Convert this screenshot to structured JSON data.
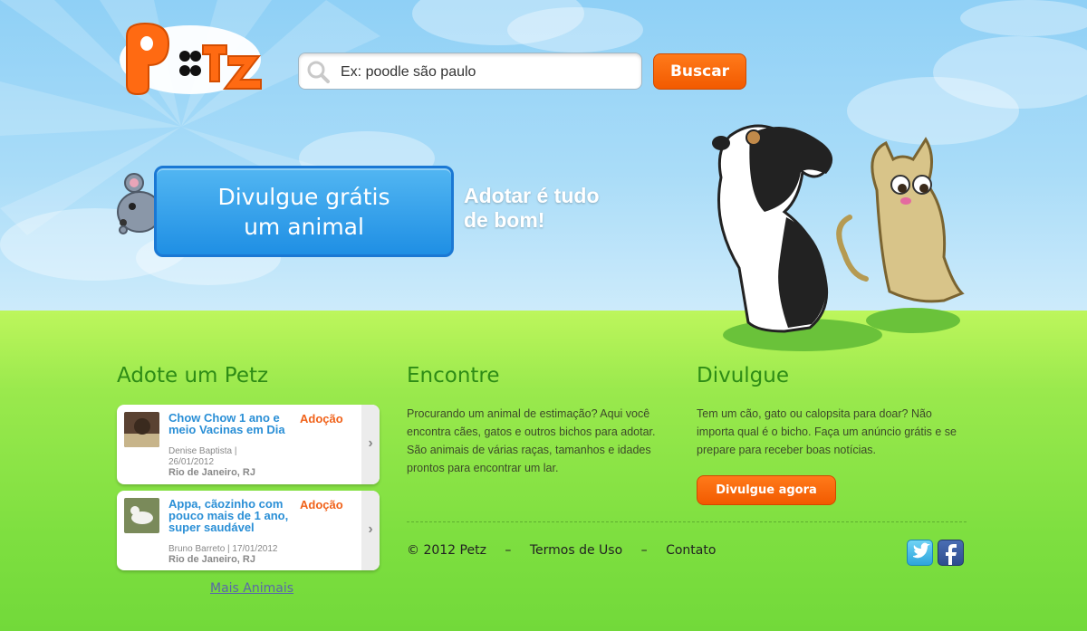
{
  "brand": {
    "logo_text": "PETZ"
  },
  "search": {
    "placeholder": "Ex: poodle são paulo",
    "button_label": "Buscar"
  },
  "hero": {
    "promo_line1": "Divulgue grátis",
    "promo_line2": "um animal",
    "tagline_line1": "Adotar é tudo",
    "tagline_line2": "de bom!"
  },
  "adote": {
    "title": "Adote um Petz",
    "cards": [
      {
        "title": "Chow Chow 1 ano e meio Vacinas em Dia",
        "tag": "Adoção",
        "author": "Denise Baptista |",
        "date": "26/01/2012",
        "location": "Rio de Janeiro, RJ"
      },
      {
        "title": "Appa, cãozinho com pouco mais de 1 ano, super saudável",
        "tag": "Adoção",
        "meta": "Bruno Barreto | 17/01/2012",
        "location": "Rio de Janeiro, RJ"
      }
    ],
    "more_link": "Mais Animais"
  },
  "encontre": {
    "title": "Encontre",
    "text": "Procurando um animal de estimação? Aqui você encontra cães, gatos e outros bichos para adotar. São animais de várias raças, tamanhos e idades prontos para encontrar um lar."
  },
  "divulgue": {
    "title": "Divulgue",
    "text": "Tem um cão, gato ou calopsita para doar? Não importa qual é o bicho. Faça um anúncio grátis e se prepare para receber boas notícias.",
    "button_label": "Divulgue agora"
  },
  "footer": {
    "copyright": "© 2012 Petz",
    "separator": "–",
    "terms": "Termos de Uso",
    "contact": "Contato"
  },
  "colors": {
    "accent_orange": "#f25a00",
    "promo_blue": "#1f8fe4",
    "heading_green": "#2e8c16",
    "link_blue": "#2a8fd6"
  },
  "icons": {
    "twitter": "twitter-icon",
    "facebook": "facebook-icon"
  }
}
